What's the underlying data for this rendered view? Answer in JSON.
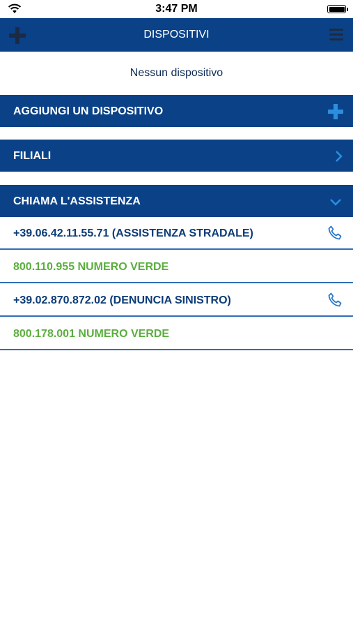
{
  "status_bar": {
    "time": "3:47 PM"
  },
  "nav": {
    "title": "DISPOSITIVI"
  },
  "devices": {
    "empty_message": "Nessun dispositivo"
  },
  "sections": {
    "add_device": "AGGIUNGI UN DISPOSITIVO",
    "branches": "FILIALI",
    "call_support": "CHIAMA L'ASSISTENZA"
  },
  "support_rows": [
    {
      "label": "+39.06.42.11.55.71 (ASSISTENZA STRADALE)",
      "style": "phone"
    },
    {
      "label": "800.110.955 NUMERO VERDE",
      "style": "toll-free"
    },
    {
      "label": "+39.02.870.872.02 (DENUNCIA SINISTRO)",
      "style": "phone"
    },
    {
      "label": "800.178.001 NUMERO VERDE",
      "style": "toll-free"
    }
  ],
  "colors": {
    "primary": "#0b4287",
    "accent": "#2b8fe0",
    "text_dark_blue": "#0b3b78",
    "toll_free_green": "#5aae3e",
    "divider": "#2f6fb3"
  },
  "icons": {
    "nav_left": "plus-icon",
    "nav_right": "hamburger-menu-icon",
    "add_device": "plus-icon",
    "branches": "chevron-right-icon",
    "call_support": "chevron-down-icon",
    "phone_rows": "phone-icon"
  }
}
